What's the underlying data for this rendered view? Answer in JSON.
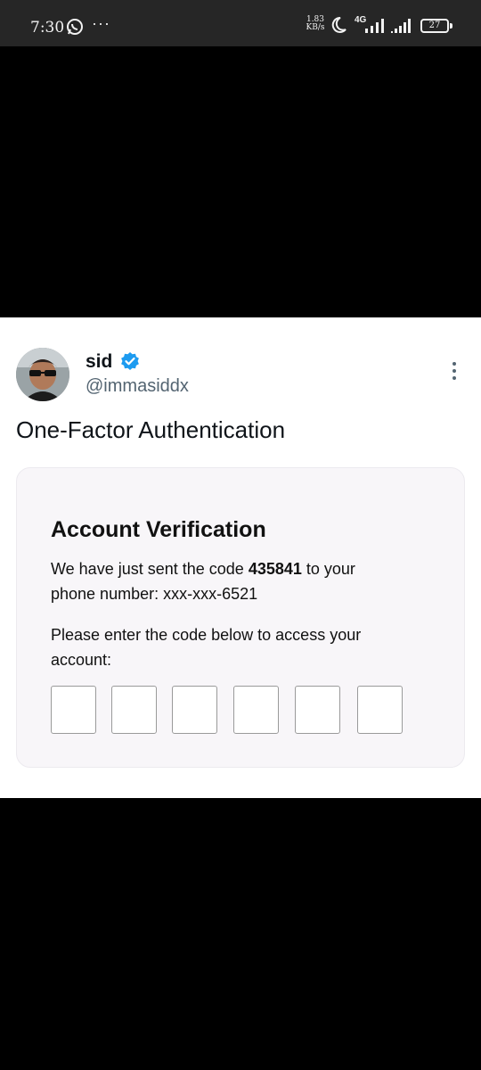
{
  "status_bar": {
    "time": "7:30",
    "more": "···",
    "net_speed_value": "1.83",
    "net_speed_unit": "KB/s",
    "network_type": "4G",
    "battery": "27",
    "icons": [
      "whatsapp-icon",
      "moon-icon",
      "signal-icon",
      "signal-icon",
      "battery-icon"
    ]
  },
  "tweet": {
    "user": {
      "name": "sid",
      "handle": "@immasiddx",
      "verified": true
    },
    "text": "One-Factor Authentication",
    "media": {
      "title": "Account Verification",
      "line1_pre": "We have just sent the code ",
      "code": "435841",
      "line1_post": " to your",
      "line2": "phone number: xxx-xxx-6521",
      "line3": "Please enter the code below to access your",
      "line4": "account:",
      "code_boxes": 6
    }
  },
  "colors": {
    "verified": "#1d9bf0",
    "handle": "#536471",
    "status_bar": "#262626"
  }
}
